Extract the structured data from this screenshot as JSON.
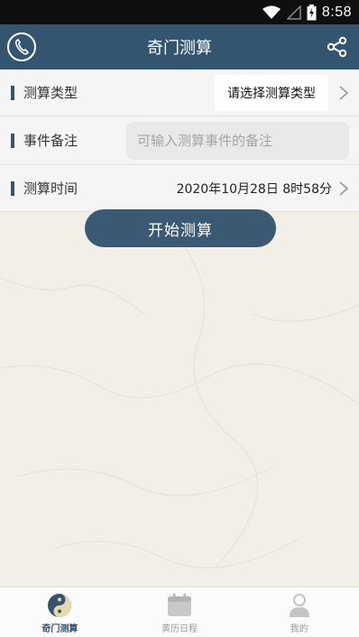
{
  "status_bar": {
    "time": "8:58"
  },
  "header": {
    "title": "奇门测算"
  },
  "form": {
    "type": {
      "label": "测算类型",
      "value": "请选择测算类型"
    },
    "note": {
      "label": "事件备注",
      "placeholder": "可输入测算事件的备注"
    },
    "time": {
      "label": "测算时间",
      "value": "2020年10月28日 8时58分"
    }
  },
  "start_button": "开始测算",
  "tabs": [
    {
      "label": "奇门测算",
      "icon": "yin-yang-icon",
      "active": true
    },
    {
      "label": "黄历日程",
      "icon": "calendar-icon",
      "active": false
    },
    {
      "label": "我的",
      "icon": "user-icon",
      "active": false
    }
  ],
  "colors": {
    "primary": "#34556f",
    "background": "#f2efe6"
  }
}
